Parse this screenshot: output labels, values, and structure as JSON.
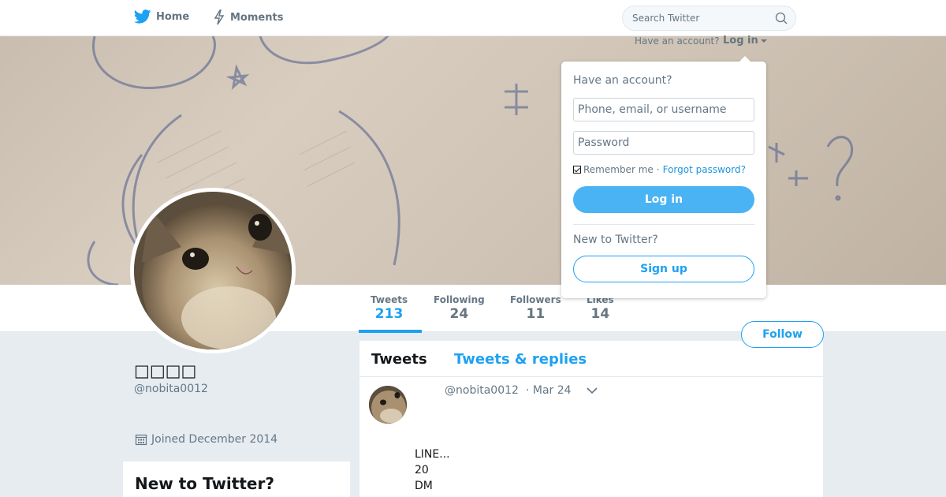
{
  "nav": {
    "home_label": "Home",
    "moments_label": "Moments",
    "search_placeholder": "Search Twitter"
  },
  "login": {
    "prompt_top": "Have an account?",
    "toggle_label": "Log in",
    "dropdown_title": "Have an account?",
    "username_placeholder": "Phone, email, or username",
    "password_placeholder": "Password",
    "remember_label": "Remember me",
    "separator": "·",
    "forgot_label": "Forgot password?",
    "login_button": "Log in",
    "new_prompt": "New to Twitter?",
    "signup_button": "Sign up"
  },
  "profile": {
    "display_name": "□□□□",
    "screen_name": "@nobita0012",
    "joined": "Joined December 2014",
    "follow_button": "Follow",
    "stats": [
      {
        "label": "Tweets",
        "value": "213"
      },
      {
        "label": "Following",
        "value": "24"
      },
      {
        "label": "Followers",
        "value": "11"
      },
      {
        "label": "Likes",
        "value": "14"
      }
    ]
  },
  "sidebar": {
    "new_to_twitter_title": "New to Twitter?"
  },
  "timeline": {
    "tabs": [
      {
        "label": "Tweets"
      },
      {
        "label": "Tweets & replies"
      }
    ],
    "tweet": {
      "handle": "@nobita0012",
      "time": "· Mar 24",
      "lines": [
        "LINE...",
        "20",
        "DM"
      ]
    }
  },
  "colors": {
    "accent": "#1da1f2",
    "login_button": "#4ab3f4",
    "background": "#e6ecf0"
  },
  "icons": {
    "home": "twitter-bird-icon",
    "moments": "lightning-icon",
    "search": "search-icon",
    "calendar": "calendar-icon",
    "caret": "chevron-down-icon"
  }
}
